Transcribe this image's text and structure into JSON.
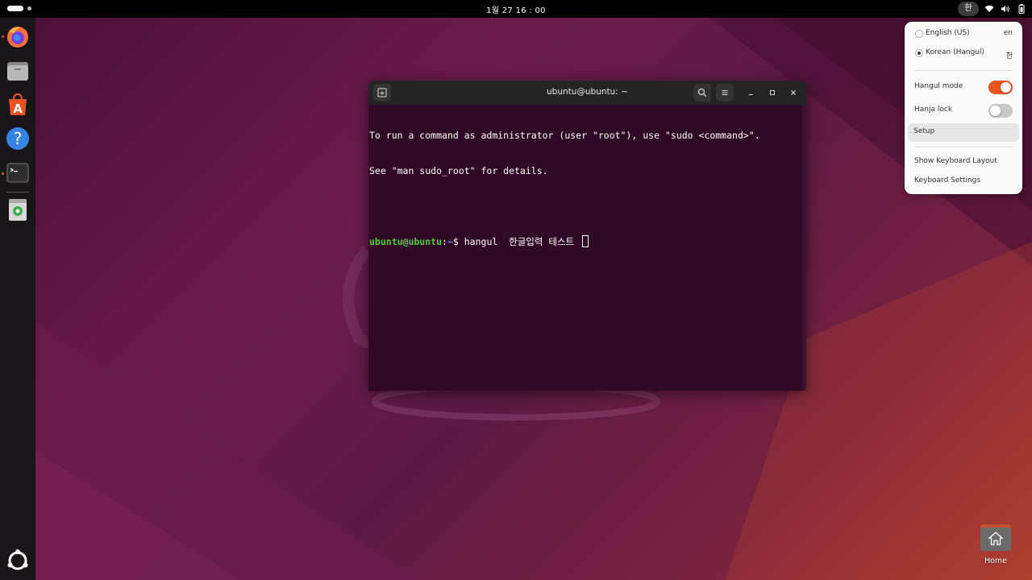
{
  "topbar": {
    "clock": "1월 27  16 : 00",
    "ime_indicator": "한"
  },
  "dock": {
    "items": [
      {
        "name": "firefox",
        "running": true
      },
      {
        "name": "files",
        "running": false
      },
      {
        "name": "app-center",
        "running": false
      },
      {
        "name": "help",
        "running": false
      },
      {
        "name": "terminal",
        "running": true
      },
      {
        "name": "trash",
        "running": false
      }
    ]
  },
  "terminal": {
    "title": "ubuntu@ubuntu: ~",
    "lines": [
      "To run a command as administrator (user \"root\"), use \"sudo <command>\".",
      "See \"man sudo_root\" for details."
    ],
    "prompt_user": "ubuntu@ubuntu",
    "prompt_sep": ":",
    "prompt_path": "~",
    "prompt_symbol": "$ ",
    "command": "hangul  한글입력 테스트 "
  },
  "ime_menu": {
    "sources": [
      {
        "label": "English (US)",
        "short": "en",
        "selected": false
      },
      {
        "label": "Korean (Hangul)",
        "short": "한",
        "selected": true
      }
    ],
    "hangul_mode": {
      "label": "Hangul mode",
      "on": true
    },
    "hanja_lock": {
      "label": "Hanja lock",
      "on": false
    },
    "setup": "Setup",
    "show_layout": "Show Keyboard Layout",
    "keyboard_settings": "Keyboard Settings"
  },
  "desktop": {
    "home_label": "Home"
  },
  "colors": {
    "accent": "#e95420",
    "terminal_bg": "#300a24",
    "prompt_user": "#4fcf3f",
    "prompt_path": "#6aa0ff"
  }
}
